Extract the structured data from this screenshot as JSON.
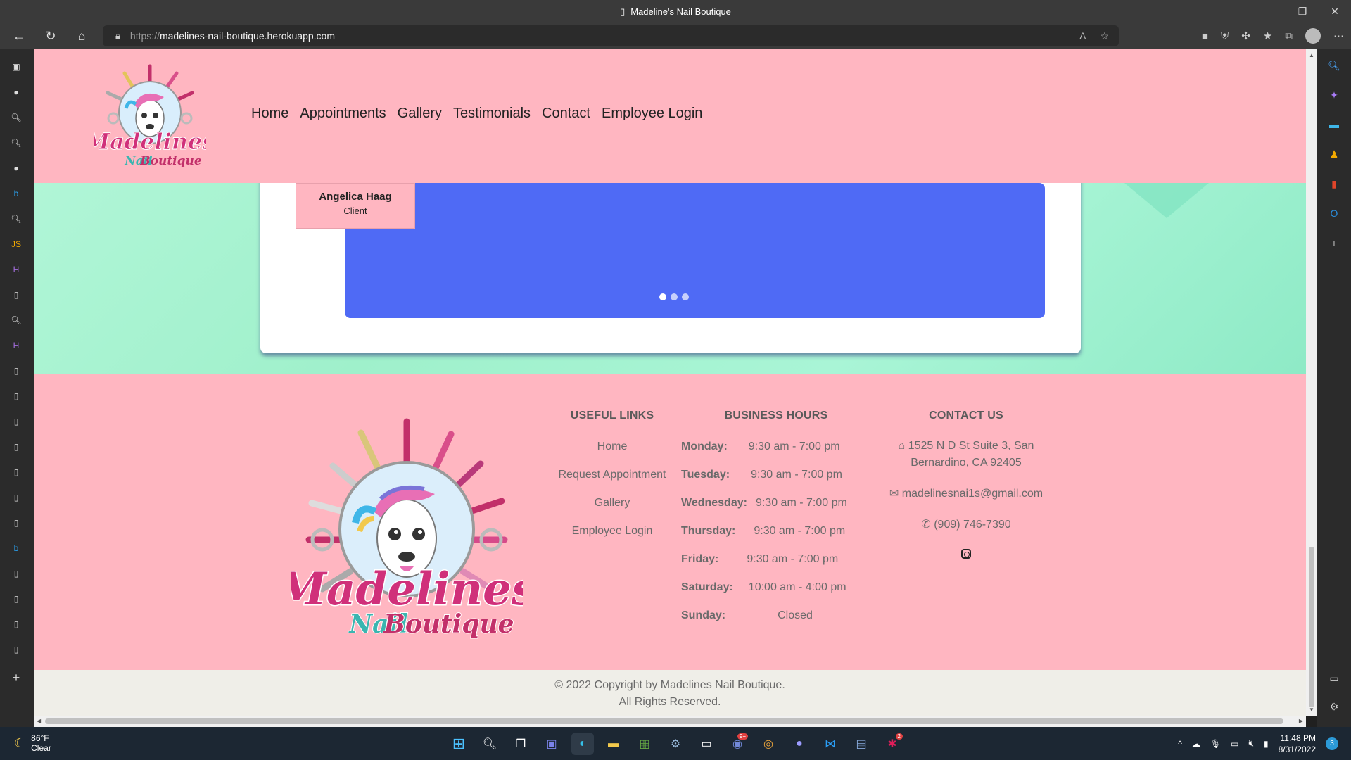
{
  "browser": {
    "window_title": "Madeline's Nail Boutique",
    "url_protocol": "https://",
    "url_host": "madelines-nail-boutique.herokuapp.com"
  },
  "site": {
    "nav": [
      "Home",
      "Appointments",
      "Gallery",
      "Testimonials",
      "Contact",
      "Employee Login"
    ],
    "testimonial": {
      "client_name": "Angelica Haag",
      "client_role": "Client",
      "slide_count": 3,
      "active_slide": 1
    },
    "footer": {
      "useful_links_title": "USEFUL LINKS",
      "useful_links": [
        "Home",
        "Request Appointment",
        "Gallery",
        "Employee Login"
      ],
      "hours_title": "BUSINESS HOURS",
      "hours": [
        {
          "day": "Monday:",
          "time": "9:30 am - 7:00 pm"
        },
        {
          "day": "Tuesday:",
          "time": "9:30 am - 7:00 pm"
        },
        {
          "day": "Wednesday:",
          "time": "9:30 am - 7:00 pm"
        },
        {
          "day": "Thursday:",
          "time": "9:30 am - 7:00 pm"
        },
        {
          "day": "Friday:",
          "time": "9:30 am - 7:00 pm"
        },
        {
          "day": "Saturday:",
          "time": "10:00 am - 4:00 pm"
        },
        {
          "day": "Sunday:",
          "time": "Closed"
        }
      ],
      "contact_title": "CONTACT US",
      "address_line1": "1525 N D St Suite 3, San",
      "address_line2": "Bernardino, CA 92405",
      "email": "madelinesnai1s@gmail.com",
      "phone": "(909) 746-7390"
    },
    "copyright_line1": "© 2022 Copyright by Madelines Nail Boutique.",
    "copyright_line2": "All Rights Reserved.",
    "colors": {
      "pink": "#ffb6c1",
      "mint": "#a9f5d2",
      "carousel_blue": "#4f6af5"
    }
  },
  "taskbar": {
    "temperature": "86°F",
    "condition": "Clear",
    "time": "11:48 PM",
    "date": "8/31/2022",
    "notifications": "3",
    "discord_badge": "9+",
    "app_badge": "2"
  }
}
